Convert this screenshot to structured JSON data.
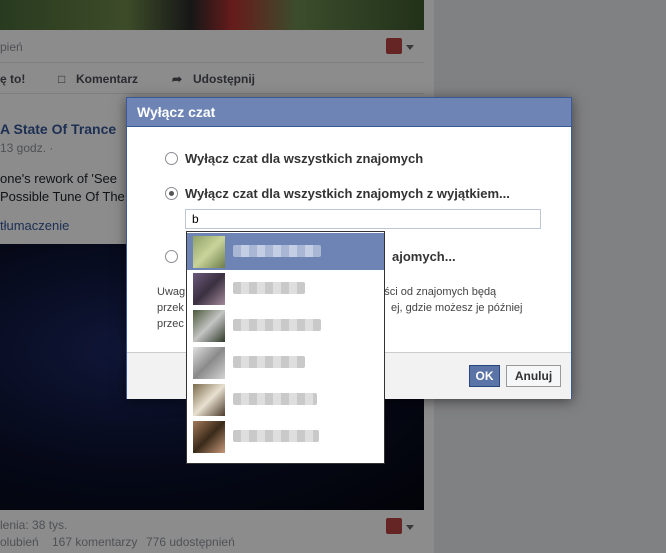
{
  "feed": {
    "likes_label_top": "pień",
    "actions": {
      "like": "ę to!",
      "comment": "Komentarz",
      "share": "Udostępnij"
    },
    "post": {
      "page_name": "A State Of Trance",
      "time": "13 godz. ·",
      "text_line1": "one's rework of 'See",
      "text_line2": "Possible Tune Of The",
      "translate": "tłumaczenie"
    },
    "stats": {
      "views": "lenia: 38 tys.",
      "likes": "olubień",
      "comments": "167 komentarzy",
      "shares": "776 udostępnień"
    }
  },
  "dialog": {
    "title": "Wyłącz czat",
    "options": [
      {
        "label": "Wyłącz czat dla wszystkich znajomych",
        "checked": false
      },
      {
        "label": "Wyłącz czat dla wszystkich znajomych z wyjątkiem...",
        "checked": true
      },
      {
        "label": "ajomych...",
        "checked": false
      }
    ],
    "input_value": "b",
    "note_lines": [
      {
        "left": "Uwag",
        "right": "mości od znajomych będą"
      },
      {
        "left": "przek",
        "right": "ej, gdzie możesz je później"
      },
      {
        "left": "przec",
        "right": ""
      }
    ],
    "ok_label": "OK",
    "cancel_label": "Anuluj"
  },
  "autocomplete": {
    "items": [
      {
        "name": "",
        "selected": true
      },
      {
        "name": "",
        "selected": false
      },
      {
        "name": "",
        "selected": false
      },
      {
        "name": "",
        "selected": false
      },
      {
        "name": "",
        "selected": false
      },
      {
        "name": "",
        "selected": false
      }
    ]
  }
}
